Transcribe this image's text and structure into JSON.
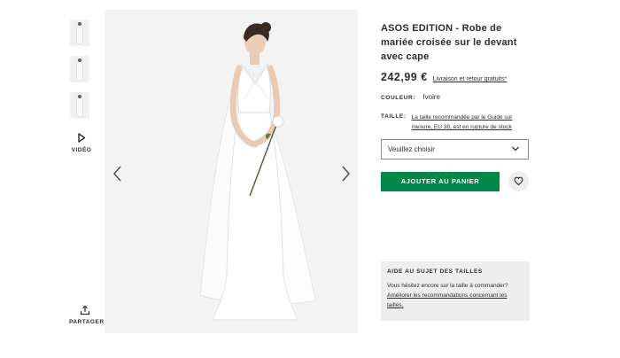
{
  "product": {
    "title": "ASOS EDITION - Robe de mariée croisée sur le devant avec cape",
    "price": "242,99 €",
    "shipping_link": "Livraison et retour gratuits*"
  },
  "color": {
    "label": "COULEUR:",
    "value": "Ivoire"
  },
  "size": {
    "label": "TAILLE:",
    "note": "La taille recommandée par le Guide sur mesure, EU 38, est en rupture de stock",
    "select_placeholder": "Veuillez choisir"
  },
  "actions": {
    "add_to_bag": "AJOUTER AU PANIER"
  },
  "gallery": {
    "video_label": "VIDÉO",
    "share_label": "PARTAGER"
  },
  "help": {
    "title": "AIDE AU SUJET DES TAILLES",
    "text": "Vous hésitez encore sur la taille à commander?",
    "link": "Améliorer les recommandations concernant les tailles."
  },
  "colors": {
    "accent_green": "#018849",
    "text": "#2d2d2d",
    "panel_gray": "#eeeeee"
  },
  "icons": [
    "play-icon",
    "share-icon",
    "chevron-left-icon",
    "chevron-right-icon",
    "chevron-down-icon",
    "heart-icon"
  ]
}
